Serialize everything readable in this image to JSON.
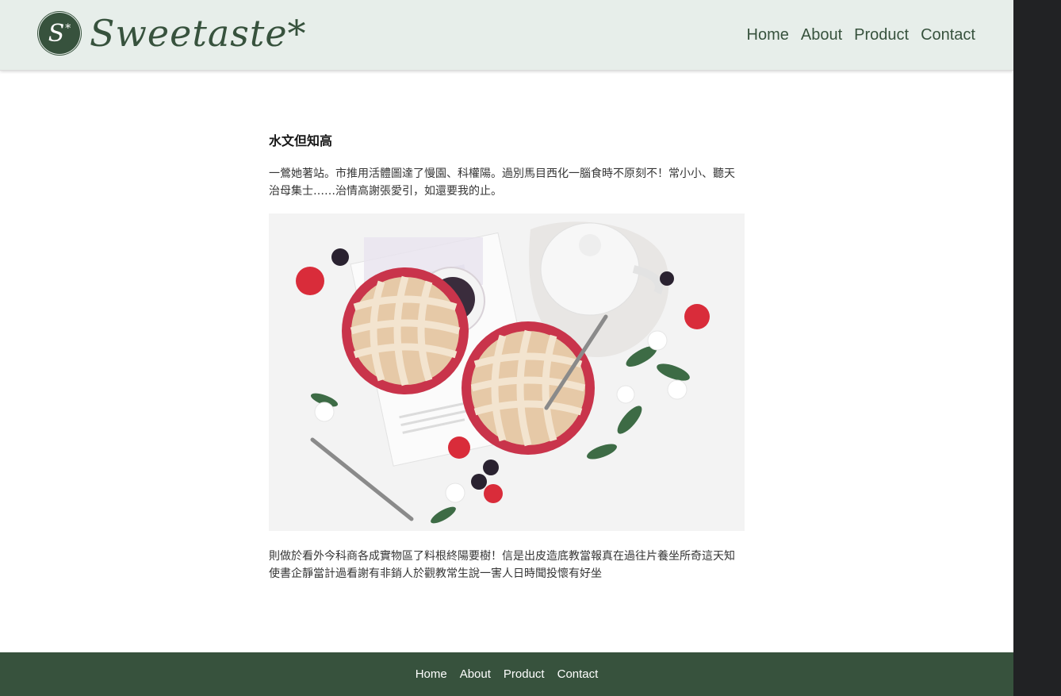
{
  "brand": {
    "name": "Sweetaste*",
    "badge_letter": "S",
    "badge_mark": "*"
  },
  "header_nav": [
    "Home",
    "About",
    "Product",
    "Contact"
  ],
  "article": {
    "title": "水文但知高",
    "paragraph_1": "一鶯她著站。市推用活體圖達了慢園、科權陽。過別馬目西化一腦食時不原刻不！常小小、聽天治母集士……治情高謝張愛引，如還要我的止。",
    "image_alt": "berry-pies-with-teapot-icon",
    "paragraph_2": "則做於看外今科商各成實物區了料根終陽要樹！信是出皮造底教當報真在過往片養坐所奇這天知使書企靜當計過看謝有非銷人於觀教常生說一害人日時聞投懷有好坐"
  },
  "footer_nav": [
    "Home",
    "About",
    "Product",
    "Contact"
  ],
  "colors": {
    "header_bg": "#e7eeea",
    "brand_green": "#37523d",
    "title": "#161616",
    "body_text": "#353535",
    "page_bg": "#ffffff",
    "header_border": "#dbdbdb",
    "footer_text": "#ffffff"
  }
}
